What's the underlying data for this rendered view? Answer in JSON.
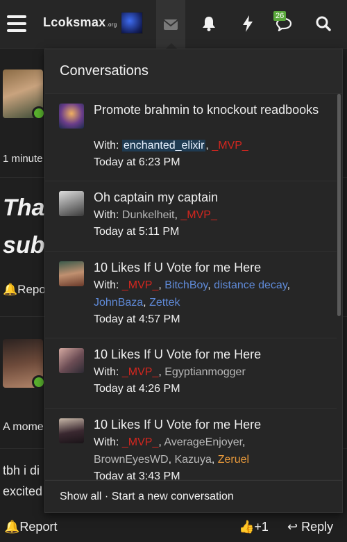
{
  "header": {
    "logo_main": "Lcoksmax",
    "logo_suffix": ".org",
    "alerts_badge": "26"
  },
  "background_post": {
    "time_snippet": "1 minute",
    "big_text_line1": "Tha",
    "big_text_line2": "subr",
    "report_label": "Repo",
    "snippet2": "A mome",
    "snippet3": "tbh i di",
    "snippet4": "excited"
  },
  "bottom_bar": {
    "report": "Report",
    "like_count": "+1",
    "reply": "Reply"
  },
  "dropdown": {
    "title": "Conversations",
    "footer_show_all": "Show all",
    "footer_sep": " · ",
    "footer_new": "Start a new conversation",
    "conversations": [
      {
        "title": "Promote brahmin to knockout readbooks",
        "with_label": "With: ",
        "participants": [
          {
            "name": "enchanted_elixir",
            "style": "hl"
          },
          {
            "name": "_MVP_",
            "style": "red"
          }
        ],
        "time": "Today at 6:23 PM"
      },
      {
        "title": "Oh captain my captain",
        "with_label": "With: ",
        "participants": [
          {
            "name": "Dunkelheit",
            "style": "gray"
          },
          {
            "name": "_MVP_",
            "style": "red"
          }
        ],
        "time": "Today at 5:11 PM"
      },
      {
        "title": "10 Likes If U Vote for me Here",
        "with_label": "With: ",
        "participants": [
          {
            "name": "_MVP_",
            "style": "red"
          },
          {
            "name": "BitchBoy",
            "style": "blue"
          },
          {
            "name": "distance decay",
            "style": "blue"
          },
          {
            "name": "JohnBaza",
            "style": "blue"
          },
          {
            "name": "Zettek",
            "style": "blue"
          }
        ],
        "time": "Today at 4:57 PM"
      },
      {
        "title": "10 Likes If U Vote for me Here",
        "with_label": "With: ",
        "participants": [
          {
            "name": "_MVP_",
            "style": "red"
          },
          {
            "name": "Egyptianmogger",
            "style": "gray"
          }
        ],
        "time": "Today at 4:26 PM"
      },
      {
        "title": "10 Likes If U Vote for me Here",
        "with_label": "With: ",
        "participants": [
          {
            "name": "_MVP_",
            "style": "red"
          },
          {
            "name": "AverageEnjoyer",
            "style": "gray"
          },
          {
            "name": "BrownEyesWD",
            "style": "gray"
          },
          {
            "name": "Kazuya",
            "style": "gray"
          },
          {
            "name": "Zeruel",
            "style": "orange"
          }
        ],
        "time": "Today at 3:43 PM"
      }
    ]
  },
  "colors": {
    "username_red": "#d3261f",
    "username_blue": "#5f8ad8",
    "username_gray": "#b9b9b9",
    "username_orange": "#e99a3b",
    "online_green": "#5ab22e",
    "badge_green": "#5aa83c"
  }
}
